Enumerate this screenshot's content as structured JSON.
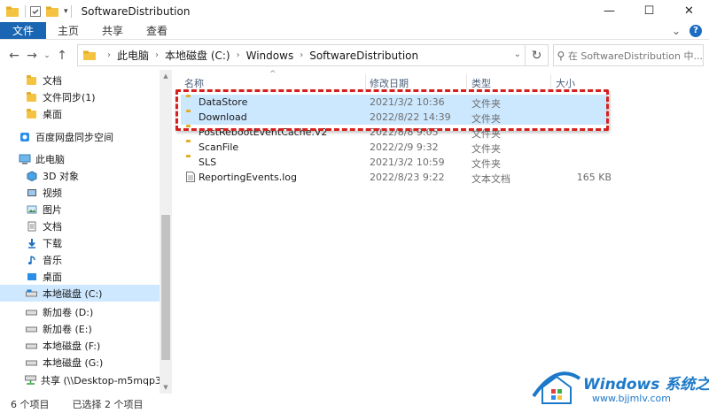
{
  "window": {
    "title": "SoftwareDistribution",
    "controls": {
      "minimize": "—",
      "maximize": "☐",
      "close": "✕"
    }
  },
  "ribbon": {
    "tabs": [
      "文件",
      "主页",
      "共享",
      "查看"
    ],
    "expand": "⌄",
    "help": "?"
  },
  "address": {
    "breadcrumb": [
      "此电脑",
      "本地磁盘 (C:)",
      "Windows",
      "SoftwareDistribution"
    ],
    "search_placeholder": "在 SoftwareDistribution 中..."
  },
  "nav_pane": {
    "items": [
      {
        "label": "文档",
        "icon": "folder-icon"
      },
      {
        "label": "文件同步(1)",
        "icon": "folder-icon"
      },
      {
        "label": "桌面",
        "icon": "folder-icon"
      },
      {
        "label": "百度网盘同步空间",
        "icon": "cloud-sync-icon"
      },
      {
        "label": "此电脑",
        "icon": "computer-icon"
      },
      {
        "label": "3D 对象",
        "icon": "cube-3d-icon"
      },
      {
        "label": "视频",
        "icon": "video-icon"
      },
      {
        "label": "图片",
        "icon": "pictures-icon"
      },
      {
        "label": "文档",
        "icon": "documents-icon"
      },
      {
        "label": "下载",
        "icon": "download-icon"
      },
      {
        "label": "音乐",
        "icon": "music-icon"
      },
      {
        "label": "桌面",
        "icon": "desktop-icon"
      },
      {
        "label": "本地磁盘 (C:)",
        "icon": "drive-icon"
      },
      {
        "label": "新加卷 (D:)",
        "icon": "drive-icon"
      },
      {
        "label": "新加卷 (E:)",
        "icon": "drive-icon"
      },
      {
        "label": "本地磁盘 (F:)",
        "icon": "drive-icon"
      },
      {
        "label": "本地磁盘 (G:)",
        "icon": "drive-icon"
      },
      {
        "label": "共享 (\\\\Desktop-m5mqp3f) (Z",
        "icon": "network-drive-icon"
      }
    ]
  },
  "file_list": {
    "columns": [
      "名称",
      "修改日期",
      "类型",
      "大小"
    ],
    "rows": [
      {
        "name": "DataStore",
        "date": "2021/3/2 10:36",
        "type": "文件夹",
        "size": "",
        "kind": "folder",
        "selected": true
      },
      {
        "name": "Download",
        "date": "2022/8/22 14:39",
        "type": "文件夹",
        "size": "",
        "kind": "folder",
        "selected": true
      },
      {
        "name": "PostRebootEventCache.V2",
        "date": "2022/8/8 9:05",
        "type": "文件夹",
        "size": "",
        "kind": "folder",
        "selected": false
      },
      {
        "name": "ScanFile",
        "date": "2022/2/9 9:32",
        "type": "文件夹",
        "size": "",
        "kind": "folder",
        "selected": false
      },
      {
        "name": "SLS",
        "date": "2021/3/2 10:59",
        "type": "文件夹",
        "size": "",
        "kind": "folder",
        "selected": false
      },
      {
        "name": "ReportingEvents.log",
        "date": "2022/8/23 9:22",
        "type": "文本文档",
        "size": "165 KB",
        "kind": "file",
        "selected": false
      }
    ]
  },
  "status": {
    "count": "6 个项目",
    "selected": "已选择 2 个项目"
  },
  "watermark": {
    "title": "Windows 系统之家",
    "url": "www.bjjmlv.com"
  },
  "colors": {
    "file_tab": "#1a66b2",
    "selection": "#cce8ff",
    "highlight_border": "#d62020",
    "folder": "#f5c342"
  }
}
